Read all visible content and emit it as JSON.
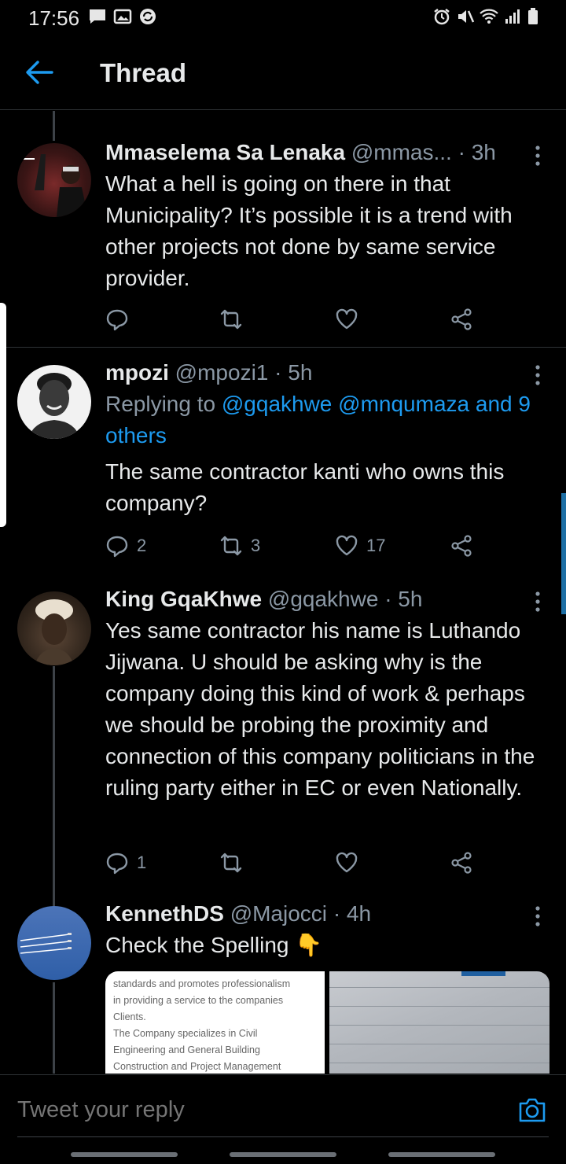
{
  "status_bar": {
    "time": "17:56"
  },
  "header": {
    "title": "Thread"
  },
  "tweets": [
    {
      "display_name": "Mmaselema Sa Lenaka",
      "handle": "@mmas...",
      "time": "· 3h",
      "text": "What a hell is going on there in that Municipality? It’s possible it is a trend with other projects not done by same service provider.",
      "reply_count": "",
      "retweet_count": "",
      "like_count": ""
    },
    {
      "display_name": "mpozi",
      "handle": "@mpozi1",
      "time": "· 5h",
      "replying_prefix": "Replying to",
      "replying_mentions": "@gqakhwe @mnqumaza and 9 others",
      "text": "The same contractor kanti who owns this company?",
      "reply_count": "2",
      "retweet_count": "3",
      "like_count": "17"
    },
    {
      "display_name": "King GqaKhwe",
      "handle": "@gqakhwe",
      "time": "· 5h",
      "text": "Yes same contractor his name is Luthando Jijwana. U should be asking why is the company doing this kind of work & perhaps we should be probing the proximity and connection of this company politicians in the ruling party either in EC or even Nationally.",
      "reply_count": "1",
      "retweet_count": "",
      "like_count": ""
    },
    {
      "display_name": "KennethDS",
      "handle": "@Majocci",
      "time": "· 4h",
      "text": "Check the Spelling",
      "emoji": "👇",
      "media_doc_lines": [
        "standards and promotes professionalism",
        "in providing a service to the companies",
        "Clients.",
        "The Company specializes in Civil",
        "Engineering and General Building",
        "Construction and Project Management"
      ]
    }
  ],
  "reply_bar": {
    "placeholder": "Tweet your reply"
  },
  "colors": {
    "background": "#000000",
    "accent": "#1d9bf0",
    "muted": "#8b98a5",
    "text": "#e7e9ea"
  }
}
